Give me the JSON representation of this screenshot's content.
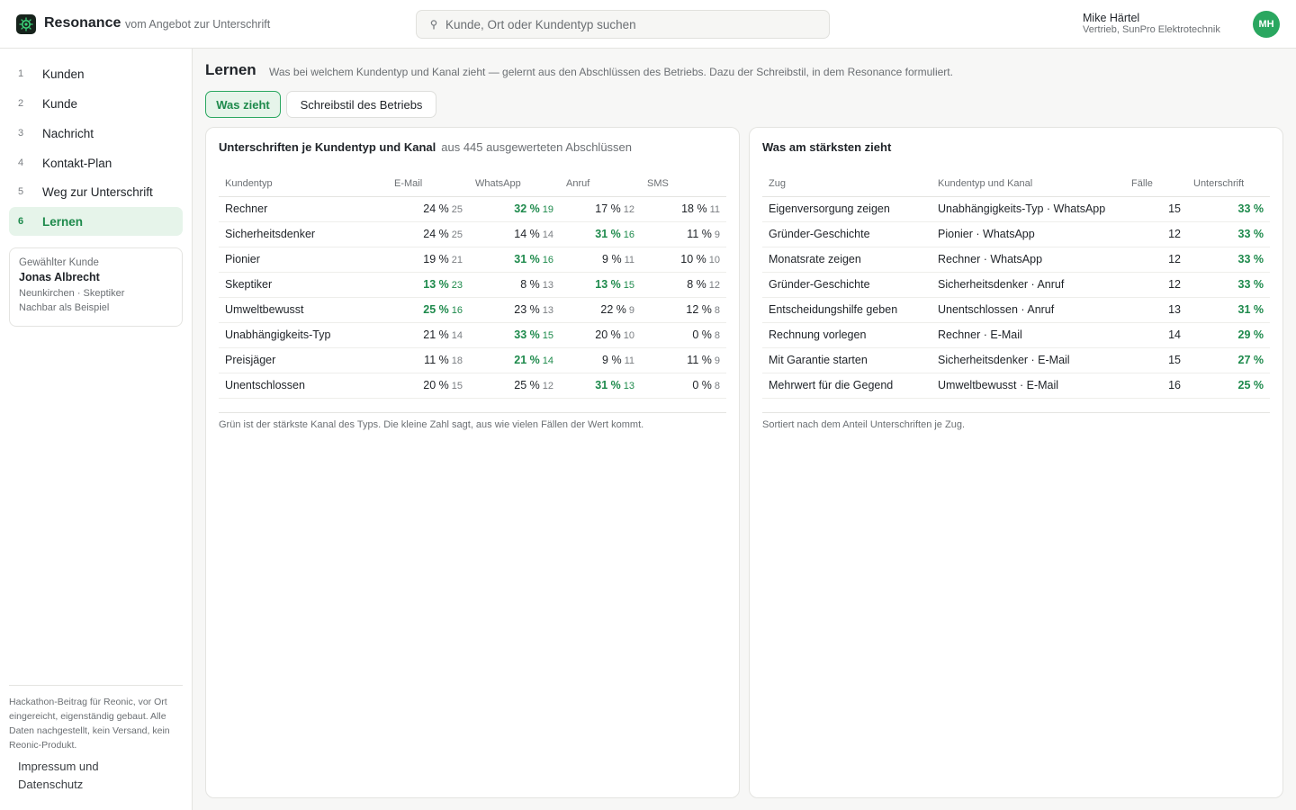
{
  "header": {
    "brand": "Resonance",
    "tagline": "vom Angebot zur Unterschrift",
    "search_placeholder": "Kunde, Ort oder Kundentyp suchen",
    "user_name": "Mike Härtel",
    "user_role": "Vertrieb, SunPro Elektrotechnik",
    "user_initials": "MH",
    "accent": "#2aa760"
  },
  "sidebar": {
    "items": [
      {
        "num": "1",
        "label": "Kunden"
      },
      {
        "num": "2",
        "label": "Kunde"
      },
      {
        "num": "3",
        "label": "Nachricht"
      },
      {
        "num": "4",
        "label": "Kontakt-Plan"
      },
      {
        "num": "5",
        "label": "Weg zur Unterschrift"
      },
      {
        "num": "6",
        "label": "Lernen"
      }
    ],
    "customer": {
      "caption": "Gewählter Kunde",
      "name": "Jonas Albrecht",
      "meta": "Neunkirchen · Skeptiker",
      "note": "Nachbar als Beispiel"
    },
    "footer": "Hackathon-Beitrag für Reonic, vor Ort eingereicht, eigenständig gebaut. Alle Daten nachgestellt, kein Versand, kein Reonic-Produkt.",
    "legal": "Impressum und Datenschutz"
  },
  "main": {
    "title": "Lernen",
    "description": "Was bei welchem Kundentyp und Kanal zieht — gelernt aus den Abschlüssen des Betriebs. Dazu der Schreibstil, in dem Resonance formuliert.",
    "tabs": [
      {
        "label": "Was zieht"
      },
      {
        "label": "Schreibstil des Betriebs"
      }
    ]
  },
  "left_panel": {
    "title": "Unterschriften je Kundentyp und Kanal",
    "subtitle": "aus 445 ausgewerteten Abschlüssen",
    "headers": [
      "Kundentyp",
      "E-Mail",
      "WhatsApp",
      "Anruf",
      "SMS"
    ],
    "rows": [
      {
        "type": "Rechner",
        "cells": [
          [
            "24 %",
            "25"
          ],
          [
            "32 %",
            "19"
          ],
          [
            "17 %",
            "12"
          ],
          [
            "18 %",
            "11"
          ]
        ],
        "best": 1
      },
      {
        "type": "Sicherheitsdenker",
        "cells": [
          [
            "24 %",
            "25"
          ],
          [
            "14 %",
            "14"
          ],
          [
            "31 %",
            "16"
          ],
          [
            "11 %",
            "9"
          ]
        ],
        "best": 2
      },
      {
        "type": "Pionier",
        "cells": [
          [
            "19 %",
            "21"
          ],
          [
            "31 %",
            "16"
          ],
          [
            "9 %",
            "11"
          ],
          [
            "10 %",
            "10"
          ]
        ],
        "best": 1
      },
      {
        "type": "Skeptiker",
        "cells": [
          [
            "13 %",
            "23"
          ],
          [
            "8 %",
            "13"
          ],
          [
            "13 %",
            "15"
          ],
          [
            "8 %",
            "12"
          ]
        ],
        "best": [
          0,
          2
        ]
      },
      {
        "type": "Umweltbewusst",
        "cells": [
          [
            "25 %",
            "16"
          ],
          [
            "23 %",
            "13"
          ],
          [
            "22 %",
            "9"
          ],
          [
            "12 %",
            "8"
          ]
        ],
        "best": 0
      },
      {
        "type": "Unabhängigkeits-Typ",
        "cells": [
          [
            "21 %",
            "14"
          ],
          [
            "33 %",
            "15"
          ],
          [
            "20 %",
            "10"
          ],
          [
            "0 %",
            "8"
          ]
        ],
        "best": 1
      },
      {
        "type": "Preisjäger",
        "cells": [
          [
            "11 %",
            "18"
          ],
          [
            "21 %",
            "14"
          ],
          [
            "9 %",
            "11"
          ],
          [
            "11 %",
            "9"
          ]
        ],
        "best": 1
      },
      {
        "type": "Unentschlossen",
        "cells": [
          [
            "20 %",
            "15"
          ],
          [
            "25 %",
            "12"
          ],
          [
            "31 %",
            "13"
          ],
          [
            "0 %",
            "8"
          ]
        ],
        "best": 2
      }
    ],
    "note": "Grün ist der stärkste Kanal des Typs. Die kleine Zahl sagt, aus wie vielen Fällen der Wert kommt."
  },
  "right_panel": {
    "title": "Was am stärksten zieht",
    "headers": [
      "Zug",
      "Kundentyp und Kanal",
      "Fälle",
      "Unterschrift"
    ],
    "rows": [
      {
        "move": "Eigenversorgung zeigen",
        "target": "Unabhängigkeits-Typ · WhatsApp",
        "cases": "15",
        "rate": "33 %"
      },
      {
        "move": "Gründer-Geschichte",
        "target": "Pionier · WhatsApp",
        "cases": "12",
        "rate": "33 %"
      },
      {
        "move": "Monatsrate zeigen",
        "target": "Rechner · WhatsApp",
        "cases": "12",
        "rate": "33 %"
      },
      {
        "move": "Gründer-Geschichte",
        "target": "Sicherheitsdenker · Anruf",
        "cases": "12",
        "rate": "33 %"
      },
      {
        "move": "Entscheidungshilfe geben",
        "target": "Unentschlossen · Anruf",
        "cases": "13",
        "rate": "31 %"
      },
      {
        "move": "Rechnung vorlegen",
        "target": "Rechner · E-Mail",
        "cases": "14",
        "rate": "29 %"
      },
      {
        "move": "Mit Garantie starten",
        "target": "Sicherheitsdenker · E-Mail",
        "cases": "15",
        "rate": "27 %"
      },
      {
        "move": "Mehrwert für die Gegend",
        "target": "Umweltbewusst · E-Mail",
        "cases": "16",
        "rate": "25 %"
      }
    ],
    "note": "Sortiert nach dem Anteil Unterschriften je Zug."
  }
}
